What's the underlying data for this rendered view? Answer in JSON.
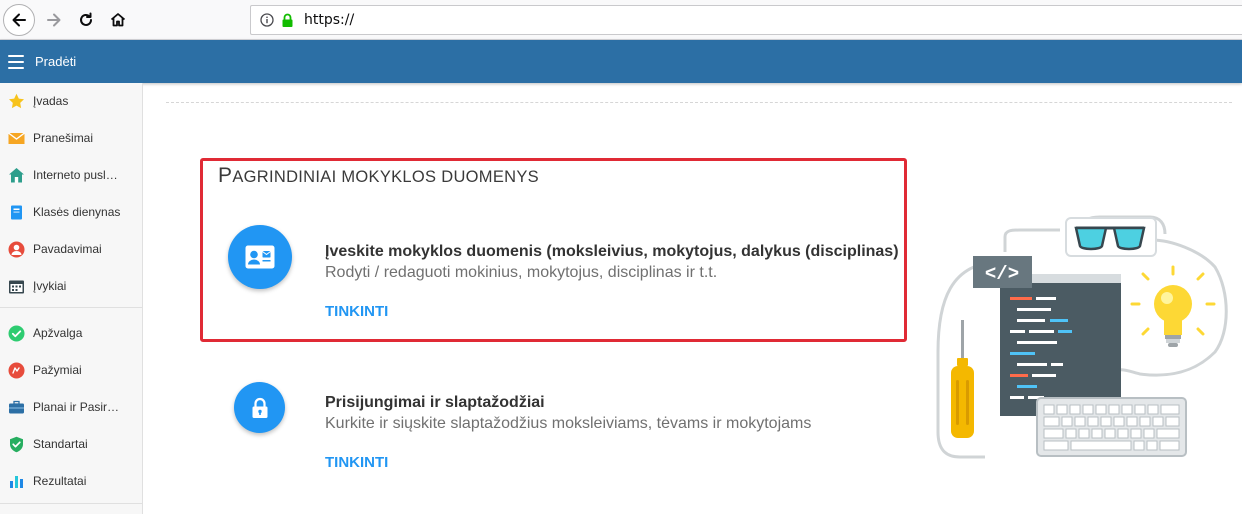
{
  "browser": {
    "url": "https://"
  },
  "header": {
    "title": "Pradėti"
  },
  "sidebar": {
    "items": [
      {
        "label": "Įvadas",
        "icon": "star-icon"
      },
      {
        "label": "Pranešimai",
        "icon": "envelope-icon"
      },
      {
        "label": "Interneto pusl…",
        "icon": "house-icon"
      },
      {
        "label": "Klasės dienynas",
        "icon": "book-icon"
      },
      {
        "label": "Pavadavimai",
        "icon": "person-icon"
      },
      {
        "label": "Įvykiai",
        "icon": "calendar-icon"
      },
      {
        "label": "Apžvalga",
        "icon": "check-circle-icon"
      },
      {
        "label": "Pažymiai",
        "icon": "grade-icon"
      },
      {
        "label": "Planai ir Pasir…",
        "icon": "briefcase-icon"
      },
      {
        "label": "Standartai",
        "icon": "shield-check-icon"
      },
      {
        "label": "Rezultatai",
        "icon": "bar-chart-icon"
      }
    ]
  },
  "main": {
    "section_title_first": "P",
    "section_title_rest": "AGRINDINIAI MOKYKLOS DUOMENYS",
    "cards": [
      {
        "heading": "Įveskite mokyklos duomenis (moksleivius, mokytojus, dalykus (disciplinas)",
        "subtitle": "Rodyti / redaguoti mokinius, mokytojus, disciplinas ir t.t.",
        "action": "TINKINTI",
        "icon": "id-card-icon"
      },
      {
        "heading": "Prisijungimai ir slaptažodžiai",
        "subtitle": "Kurkite ir siųskite slaptažodžius moksleiviams, tėvams ir mokytojams",
        "action": "TINKINTI",
        "icon": "lock-icon"
      }
    ]
  },
  "illustration": {
    "code_tag": "</>"
  },
  "colors": {
    "header": "#2c6fa5",
    "accent": "#2196f3",
    "highlight": "#e02a35"
  }
}
